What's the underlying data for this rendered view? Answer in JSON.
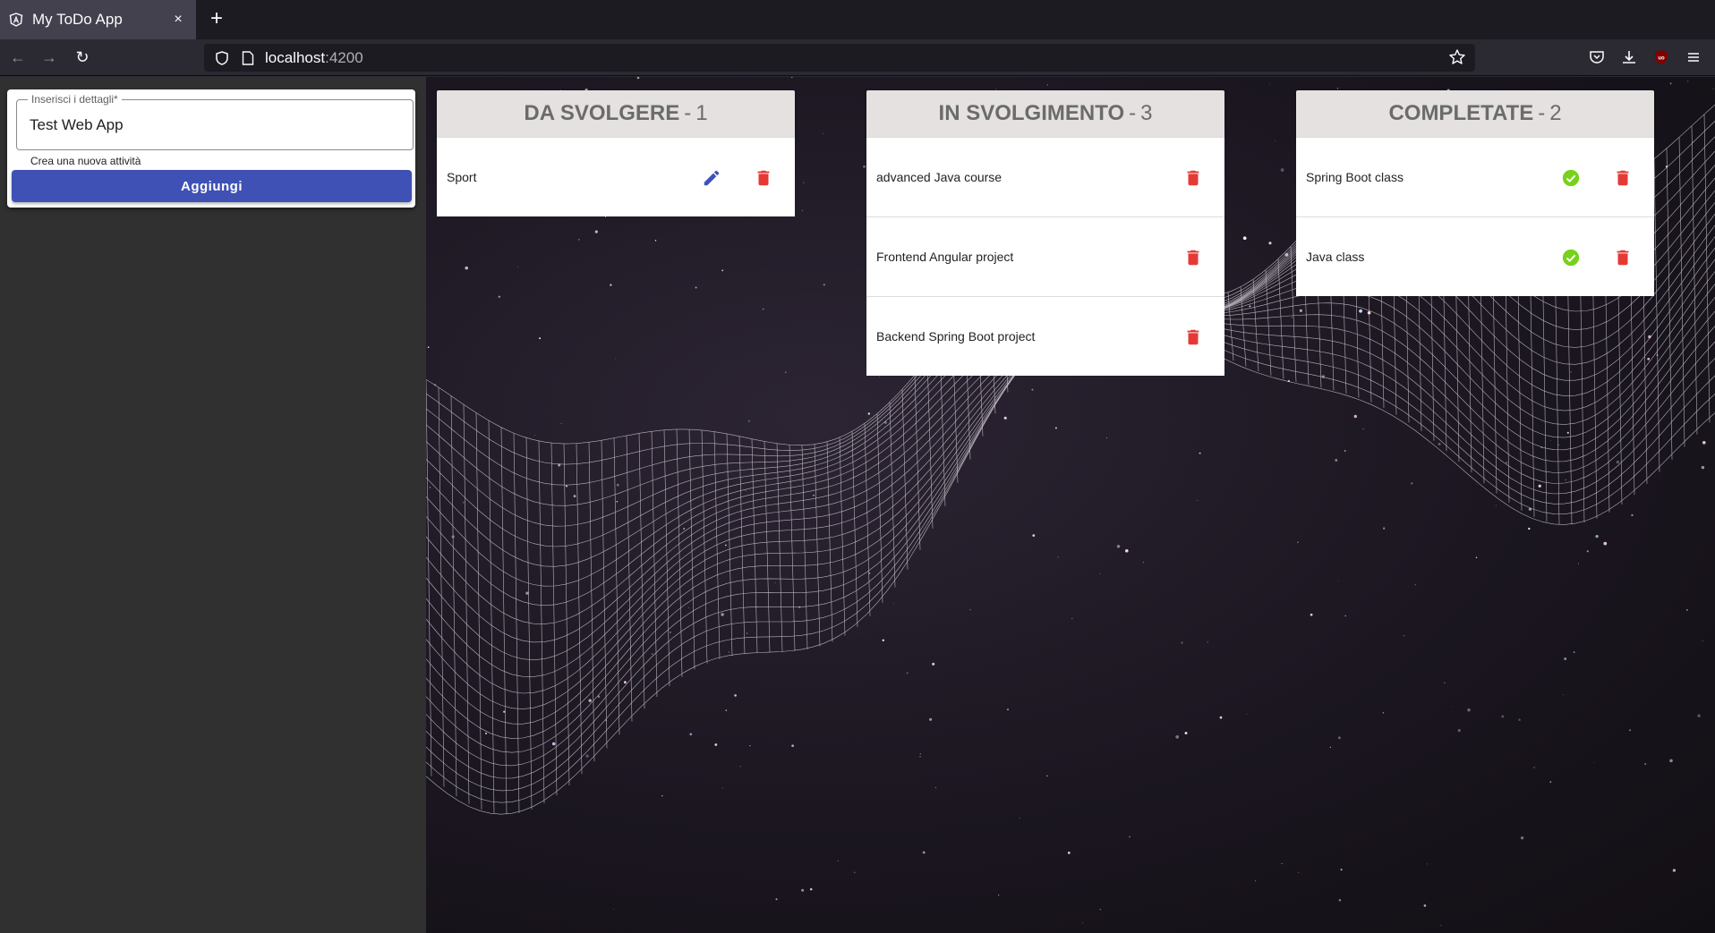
{
  "browser": {
    "tab_title": "My ToDo App",
    "tab_close": "×",
    "new_tab": "+",
    "url_host": "localhost",
    "url_port": ":4200",
    "nav_back": "←",
    "nav_forward": "→",
    "nav_reload": "↻"
  },
  "form": {
    "label": "Inserisci i dettagli*",
    "value": "Test Web App",
    "hint": "Crea una nuova attività",
    "button": "Aggiungi"
  },
  "columns": [
    {
      "title": "DA SVOLGERE",
      "separator": "-",
      "count": "1",
      "tasks": [
        {
          "text": "Sport"
        }
      ]
    },
    {
      "title": "IN SVOLGIMENTO",
      "separator": "-",
      "count": "3",
      "tasks": [
        {
          "text": "advanced Java course"
        },
        {
          "text": "Frontend Angular project"
        },
        {
          "text": "Backend Spring Boot project"
        }
      ]
    },
    {
      "title": "COMPLETATE",
      "separator": "-",
      "count": "2",
      "tasks": [
        {
          "text": "Spring Boot class"
        },
        {
          "text": "Java class"
        }
      ]
    }
  ],
  "colors": {
    "primary": "#3f51b5",
    "delete": "#e53935",
    "done": "#76d21a",
    "header_bg": "#e5e1e1"
  },
  "icons": {
    "edit": "pencil-icon",
    "delete": "trash-icon",
    "done": "check-circle-icon"
  }
}
